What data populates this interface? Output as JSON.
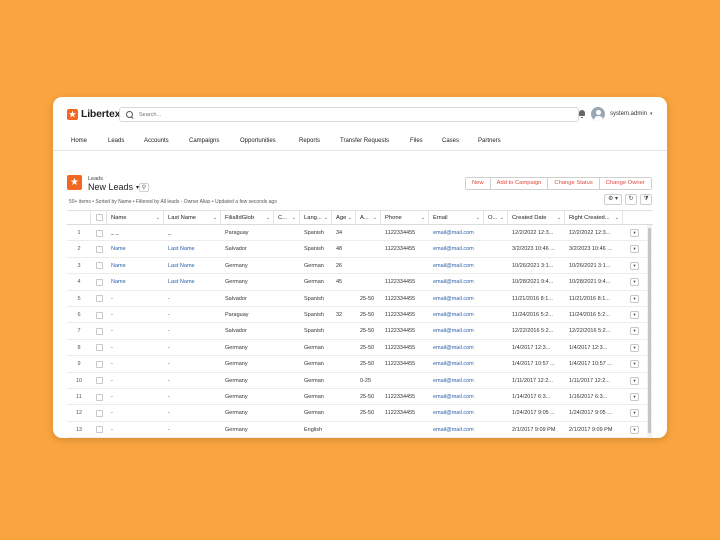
{
  "app": {
    "logo_mark": "★",
    "name": "Libertex"
  },
  "search": {
    "placeholder": "Search..."
  },
  "user": {
    "name": "system.admin",
    "caret": "▾"
  },
  "nav": [
    "Home",
    "Leads",
    "Accounts",
    "Campaigns",
    "Opportunities",
    "Reports",
    "Transfer Requests",
    "Files",
    "Cases",
    "Partners"
  ],
  "list_view": {
    "icon": "★",
    "object": "Leads",
    "title": "New Leads",
    "title_caret": "▾",
    "pin": "⚲",
    "info": "50+ items • Sorted by Name • Filtered by All leads - Owner Alias • Updated a few seconds ago",
    "buttons": [
      "New",
      "Add to Campaign",
      "Change Status",
      "Change Owner"
    ],
    "tools": {
      "settings": "⚙ ▾",
      "refresh": "↻",
      "filter": "⧩"
    }
  },
  "columns": [
    "Name",
    "Last Name",
    "FilialIdGlob",
    "C...",
    "Lang...",
    "Age",
    "A...",
    "Phone",
    "Email",
    "O...",
    "Created Date",
    "Right Created..."
  ],
  "header_caret": "⌄",
  "row_action": "▾",
  "rows": [
    {
      "n": "1",
      "name": "_ _",
      "last": "_",
      "filial": "Paraguay",
      "lang": "Spanish",
      "age": "34",
      "a": "",
      "phone": "1122334455",
      "email": "email@mail.com",
      "created": "12/2/2022 12:3...",
      "right": "12/2/2022 12:3..."
    },
    {
      "n": "2",
      "name": "Name",
      "last": "Last Name",
      "filial": "Salvador",
      "lang": "Spanish",
      "age": "48",
      "a": "",
      "phone": "1122334455",
      "email": "email@mail.com",
      "created": "3/2/2023 10:46 ...",
      "right": "3/2/2023 10:46 ..."
    },
    {
      "n": "3",
      "name": "Name",
      "last": "Last Name",
      "filial": "Germany",
      "lang": "German",
      "age": "26",
      "a": "",
      "phone": "",
      "email": "email@mail.com",
      "created": "10/26/2021 3:1...",
      "right": "10/26/2021 3:1..."
    },
    {
      "n": "4",
      "name": "Name",
      "last": "Last Name",
      "filial": "Germany",
      "lang": "German",
      "age": "45",
      "a": "",
      "phone": "1122334455",
      "email": "email@mail.com",
      "created": "10/28/2021 9:4...",
      "right": "10/28/2021 9:4..."
    },
    {
      "n": "5",
      "name": "-",
      "last": "-",
      "filial": "Salvador",
      "lang": "Spanish",
      "age": "",
      "a": "25-50",
      "phone": "1122334455",
      "email": "email@mail.com",
      "created": "11/21/2016 8:1...",
      "right": "11/21/2016 8:1..."
    },
    {
      "n": "6",
      "name": "-",
      "last": "-",
      "filial": "Paraguay",
      "lang": "Spanish",
      "age": "32",
      "a": "25-50",
      "phone": "1122334455",
      "email": "email@mail.com",
      "created": "11/24/2016 5:2...",
      "right": "11/24/2016 5:2..."
    },
    {
      "n": "7",
      "name": "-",
      "last": "-",
      "filial": "Salvador",
      "lang": "Spanish",
      "age": "",
      "a": "25-50",
      "phone": "1122334455",
      "email": "email@mail.com",
      "created": "12/22/2016 5:2...",
      "right": "12/22/2016 5:2..."
    },
    {
      "n": "8",
      "name": "-",
      "last": "-",
      "filial": "Germany",
      "lang": "German",
      "age": "",
      "a": "25-50",
      "phone": "1122334455",
      "email": "email@mail.com",
      "created": "1/4/2017 12:3...",
      "right": "1/4/2017 12:3..."
    },
    {
      "n": "9",
      "name": "-",
      "last": "-",
      "filial": "Germany",
      "lang": "German",
      "age": "",
      "a": "25-50",
      "phone": "1122334455",
      "email": "email@mail.com",
      "created": "1/4/2017 10:57 ...",
      "right": "1/4/2017 10:57 ..."
    },
    {
      "n": "10",
      "name": "-",
      "last": "-",
      "filial": "Germany",
      "lang": "German",
      "age": "",
      "a": "0-25",
      "phone": "",
      "email": "email@mail.com",
      "created": "1/11/2017 12:2...",
      "right": "1/11/2017 12:2..."
    },
    {
      "n": "11",
      "name": "-",
      "last": "-",
      "filial": "Germany",
      "lang": "German",
      "age": "",
      "a": "25-50",
      "phone": "1122334455",
      "email": "email@mail.com",
      "created": "1/14/2017 6:3...",
      "right": "1/16/2017 6:3..."
    },
    {
      "n": "12",
      "name": "-",
      "last": "-",
      "filial": "Germany",
      "lang": "German",
      "age": "",
      "a": "25-50",
      "phone": "1122334455",
      "email": "email@mail.com",
      "created": "1/24/2017 9:05 ...",
      "right": "1/24/2017 9:05 ..."
    },
    {
      "n": "13",
      "name": "-",
      "last": "-",
      "filial": "Germany",
      "lang": "English",
      "age": "",
      "a": "",
      "phone": "",
      "email": "email@mail.com",
      "created": "2/1/2017 9:09 PM",
      "right": "2/1/2017 9:09 PM"
    }
  ]
}
